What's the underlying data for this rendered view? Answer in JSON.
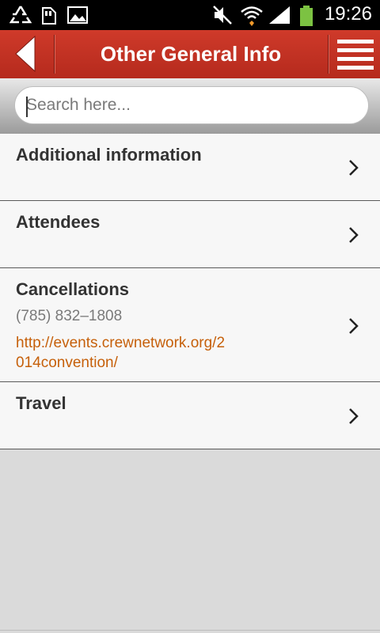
{
  "status_bar": {
    "time": "19:26",
    "icons": [
      "recycle-icon",
      "sd-card-icon",
      "image-icon",
      "mute-icon",
      "wifi-icon",
      "signal-icon",
      "battery-icon"
    ]
  },
  "header": {
    "title": "Other General Info",
    "accent_color": "#c4301f"
  },
  "search": {
    "placeholder": "Search here..."
  },
  "items": [
    {
      "title": "Additional information"
    },
    {
      "title": "Attendees"
    },
    {
      "title": "Cancellations",
      "phone": "(785) 832–1808",
      "link": "http://events.crewnetwork.org/2014convention/"
    },
    {
      "title": "Travel"
    }
  ],
  "colors": {
    "link": "#c6600a",
    "background": "#dadada"
  }
}
